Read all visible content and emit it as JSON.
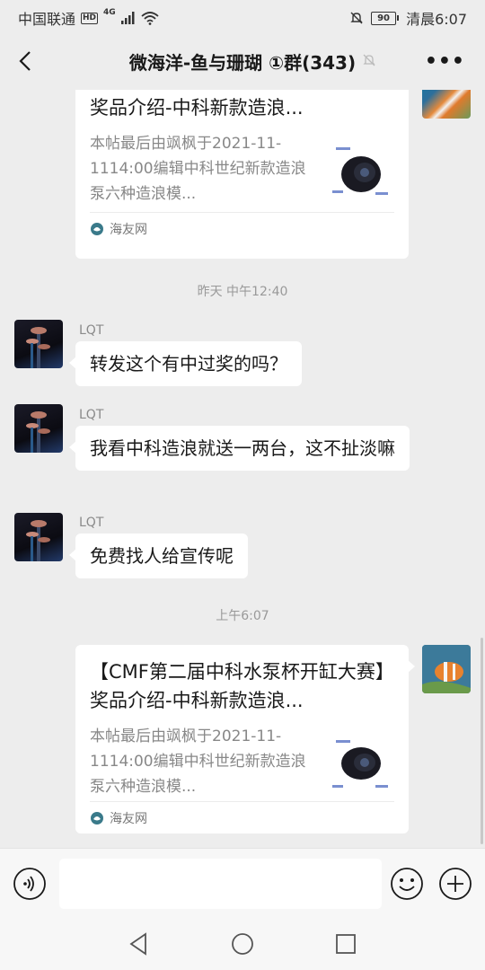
{
  "status": {
    "carrier": "中国联通",
    "hd": "HD",
    "network": "4G",
    "battery": "90",
    "time": "清晨6:07"
  },
  "header": {
    "title": "微海洋-鱼与珊瑚 ①群(343)",
    "back_icon": "chevron-left-icon",
    "mute_icon": "bell-muted-icon",
    "more_icon": "more-dots-icon"
  },
  "messages": [
    {
      "type": "card",
      "title": "【CMF第二届中科水泵杯开缸大赛】奖品介绍-中科新款造浪...",
      "desc": "本帖最后由飒枫于2021-11-1114:00编辑中科世纪新款造浪泵六种造浪模...",
      "source": "海友网"
    },
    {
      "type": "time",
      "text": "昨天 中午12:40"
    },
    {
      "type": "text",
      "sender": "LQT",
      "text": "转发这个有中过奖的吗？"
    },
    {
      "type": "text",
      "sender": "LQT",
      "text": "我看中科造浪就送一两台，这不扯淡嘛"
    },
    {
      "type": "text",
      "sender": "LQT",
      "text": "免费找人给宣传呢"
    },
    {
      "type": "time",
      "text": "上午6:07"
    },
    {
      "type": "card",
      "title": "【CMF第二届中科水泵杯开缸大赛】奖品介绍-中科新款造浪...",
      "desc": "本帖最后由飒枫于2021-11-1114:00编辑中科世纪新款造浪泵六种造浪模...",
      "source": "海友网"
    }
  ],
  "input": {
    "voice_icon": "voice-icon",
    "emoji_icon": "emoji-icon",
    "plus_icon": "plus-icon"
  },
  "nav": {
    "back": "triangle-back-icon",
    "home": "circle-home-icon",
    "recent": "square-recent-icon"
  }
}
